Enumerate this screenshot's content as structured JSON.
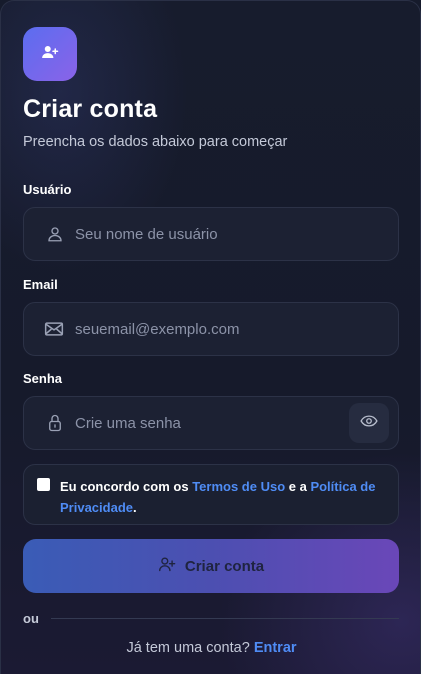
{
  "header": {
    "title": "Criar conta",
    "subtitle": "Preencha os dados abaixo para começar",
    "avatar_icon": "user-plus-icon"
  },
  "form": {
    "username": {
      "label": "Usuário",
      "placeholder": "Seu nome de usuário",
      "value": "",
      "icon": "user-icon"
    },
    "email": {
      "label": "Email",
      "placeholder": "seuemail@exemplo.com",
      "value": "",
      "icon": "mail-icon"
    },
    "password": {
      "label": "Senha",
      "placeholder": "Crie uma senha",
      "value": "",
      "icon": "lock-icon",
      "toggle_icon": "eye-icon"
    }
  },
  "terms": {
    "checked": false,
    "prefix": "Eu concordo com os ",
    "terms_link": "Termos de Uso",
    "middle": " e a ",
    "privacy_link": "Política de Privacidade",
    "suffix": "."
  },
  "submit": {
    "label": "Criar conta",
    "icon": "user-plus-icon"
  },
  "divider": {
    "label": "ou"
  },
  "footer": {
    "text": "Já tem uma conta? ",
    "link": "Entrar"
  },
  "colors": {
    "accent": "#4f8cf5",
    "gradient_start": "#3a5cb6",
    "gradient_end": "#6a47b8",
    "background": "#161b2c"
  }
}
